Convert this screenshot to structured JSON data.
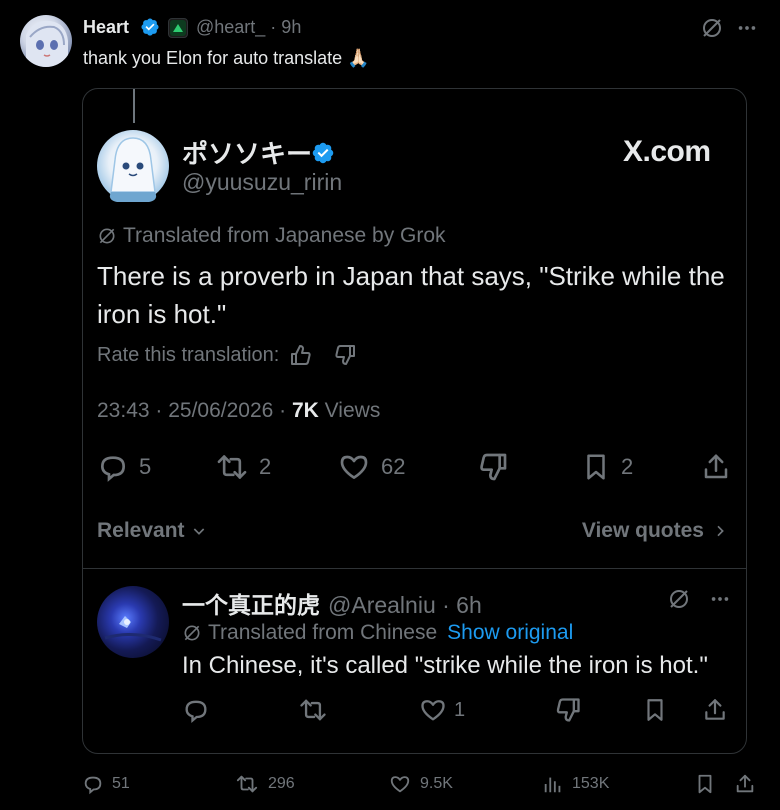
{
  "outer_post": {
    "name": "Heart",
    "handle_time": "@heart_ · 9h",
    "text": "thank you Elon for auto translate 🙏🏻",
    "actions": {
      "replies": "51",
      "reposts": "296",
      "likes": "9.5K",
      "views": "153K"
    }
  },
  "embedded_post": {
    "name": "ポソソキー",
    "handle": "@yuusuzu_ririn",
    "site": "X.com",
    "translated_label": "Translated from Japanese by Grok",
    "text": "There is a proverb in Japan that says, \"Strike while the iron is hot.\"",
    "rate_label": "Rate this translation:",
    "timestamp": "23:43 · 25/06/2026 · ",
    "views_count": "7K",
    "views_label": " Views",
    "actions": {
      "replies": "5",
      "reposts": "2",
      "likes": "62",
      "bookmarks": "2"
    },
    "sort_label": "Relevant",
    "view_quotes": "View quotes"
  },
  "reply": {
    "name": "一个真正的虎",
    "handle_time": "@Arealniu · 6h",
    "translated_label": "Translated from Chinese",
    "show_original": "Show original",
    "text": "In Chinese, it's called \"strike while the iron is hot.\"",
    "likes": "1"
  },
  "colors": {
    "background": "#000000",
    "text": "#e7e9ea",
    "muted": "#71767b",
    "accent": "#1d9bf0",
    "border": "#2f3336"
  },
  "icons": [
    "verified-badge-icon",
    "grok-icon",
    "more-icon",
    "reply-icon",
    "repost-icon",
    "like-icon",
    "dislike-icon",
    "bookmark-icon",
    "share-icon",
    "views-icon",
    "chevron-down-icon",
    "chevron-right-icon",
    "thumbs-up-icon",
    "thumbs-down-icon"
  ]
}
